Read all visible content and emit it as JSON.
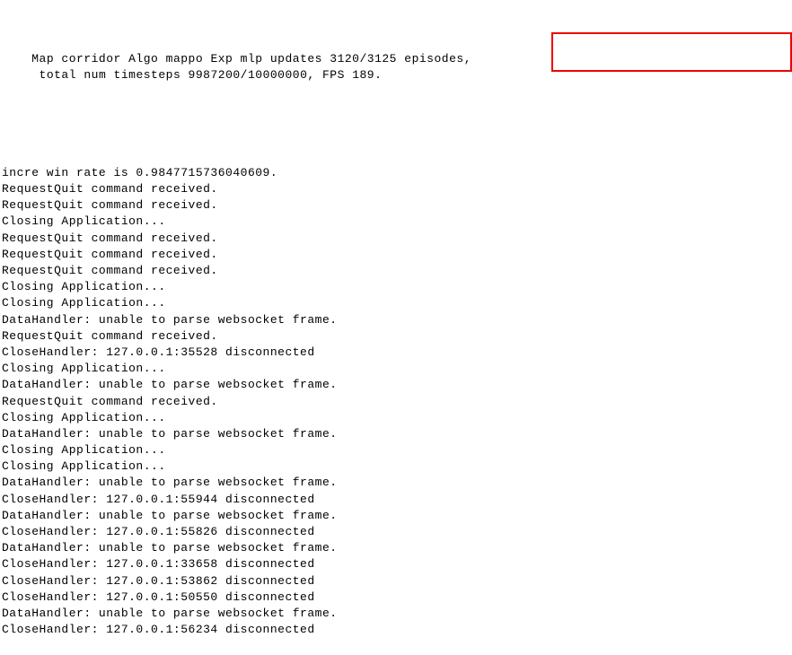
{
  "header": {
    "prefix": "Map corridor Algo mappo Exp mlp updates 3120/3125 episodes,",
    "highlighted": "total num timesteps 9987200/10000000",
    "suffix": ", FPS 189."
  },
  "lines": [
    "",
    "incre win rate is 0.9847715736040609.",
    "RequestQuit command received.",
    "RequestQuit command received.",
    "Closing Application...",
    "RequestQuit command received.",
    "RequestQuit command received.",
    "RequestQuit command received.",
    "Closing Application...",
    "Closing Application...",
    "DataHandler: unable to parse websocket frame.",
    "RequestQuit command received.",
    "CloseHandler: 127.0.0.1:35528 disconnected",
    "Closing Application...",
    "DataHandler: unable to parse websocket frame.",
    "RequestQuit command received.",
    "Closing Application...",
    "DataHandler: unable to parse websocket frame.",
    "Closing Application...",
    "Closing Application...",
    "DataHandler: unable to parse websocket frame.",
    "CloseHandler: 127.0.0.1:55944 disconnected",
    "DataHandler: unable to parse websocket frame.",
    "CloseHandler: 127.0.0.1:55826 disconnected",
    "DataHandler: unable to parse websocket frame.",
    "CloseHandler: 127.0.0.1:33658 disconnected",
    "CloseHandler: 127.0.0.1:53862 disconnected",
    "CloseHandler: 127.0.0.1:50550 disconnected",
    "DataHandler: unable to parse websocket frame.",
    "CloseHandler: 127.0.0.1:56234 disconnected"
  ]
}
